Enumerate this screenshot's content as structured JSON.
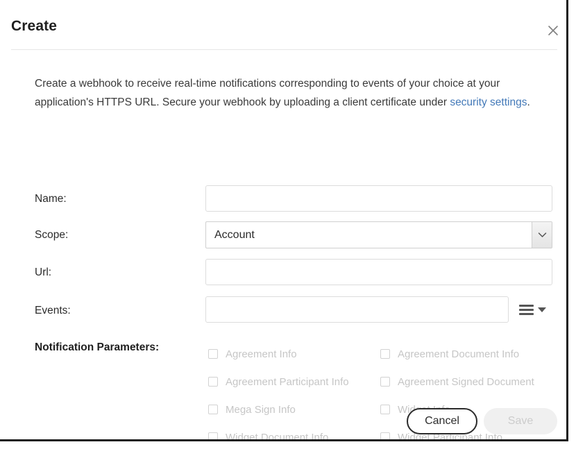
{
  "dialog": {
    "title": "Create",
    "close_icon": "close-icon",
    "intro": {
      "text_before": "Create a webhook to receive real-time notifications corresponding to events of your choice at your application's HTTPS URL. Secure your webhook by uploading a client certificate under ",
      "link_text": "security settings",
      "text_after": "."
    }
  },
  "form": {
    "name": {
      "label": "Name:",
      "value": "",
      "placeholder": ""
    },
    "scope": {
      "label": "Scope:",
      "value": "Account",
      "options": [
        "Account"
      ],
      "arrow_icon": "chevron-down-icon"
    },
    "url": {
      "label": "Url:",
      "value": "",
      "placeholder": ""
    },
    "events": {
      "label": "Events:",
      "value": "",
      "placeholder": "",
      "menu_icon": "hamburger-menu-icon",
      "caret_icon": "caret-down-icon"
    }
  },
  "notification_parameters": {
    "label": "Notification Parameters:",
    "rows": [
      {
        "left": "Agreement Info",
        "right": "Agreement Document Info"
      },
      {
        "left": "Agreement Participant Info",
        "right": "Agreement Signed Document"
      },
      {
        "left": "Mega Sign Info",
        "right": "Widget Info"
      },
      {
        "left": "Widget Document Info",
        "right": "Widget Participant Info"
      }
    ]
  },
  "footer": {
    "cancel_label": "Cancel",
    "save_label": "Save"
  },
  "colors": {
    "link": "#4379b8",
    "text": "#2b2b2b",
    "disabled_text": "#c6c6c6",
    "border": "#dcdcdc",
    "dialog_edge": "#1b1b1b"
  }
}
